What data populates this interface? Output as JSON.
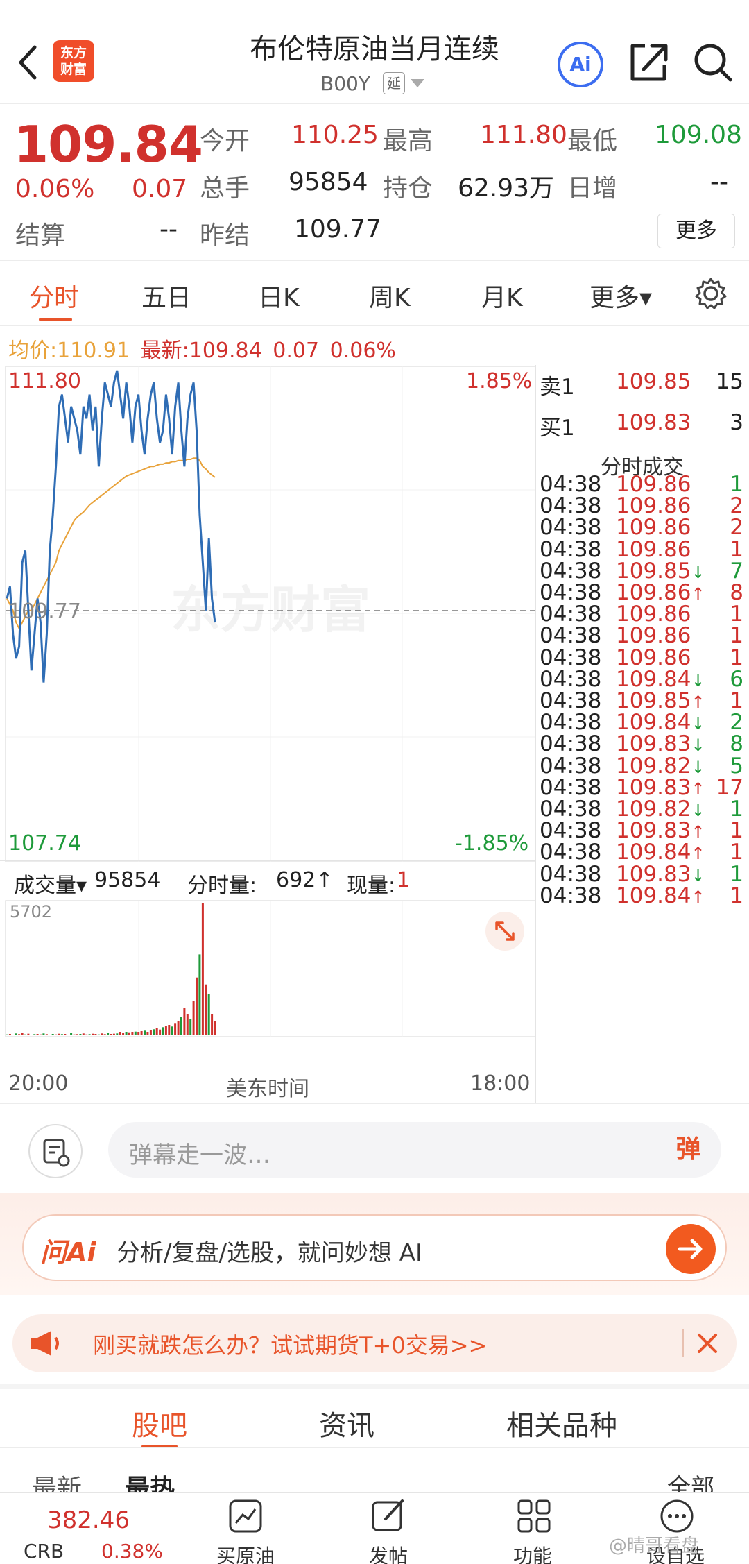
{
  "header": {
    "back_icon": "chevron-left-icon",
    "logo_text": "东方\n财富",
    "title": "布伦特原油当月连续",
    "code": "B00Y",
    "code_tag": "延",
    "ai_label": "Ai"
  },
  "quote": {
    "price": "109.84",
    "change_pct": "0.06%",
    "change": "0.07",
    "open_label": "今开",
    "open": "110.25",
    "high_label": "最高",
    "high": "111.80",
    "low_label": "最低",
    "low": "109.08",
    "volume_label": "总手",
    "volume": "95854",
    "oi_label": "持仓",
    "oi": "62.93万",
    "daily_inc_label": "日增",
    "daily_inc": "--",
    "settle_label": "结算",
    "settle": "--",
    "prev_settle_label": "昨结",
    "prev_settle": "109.77",
    "more_label": "更多"
  },
  "tabs": [
    "分时",
    "五日",
    "日K",
    "周K",
    "月K",
    "更多▾"
  ],
  "avg_line": {
    "avg_label": "均价:",
    "avg": "110.91",
    "latest_label": "最新:",
    "latest": "109.84",
    "chg": "0.07",
    "pct": "0.06%"
  },
  "chart_labels": {
    "top_price": "111.80",
    "top_pct": "1.85%",
    "mid_price": "109.77",
    "bottom_price": "107.74",
    "bottom_pct": "-1.85%",
    "watermark": "东方财富",
    "vol_max": "5702",
    "time_start": "20:00",
    "time_mid": "美东时间",
    "time_end": "18:00"
  },
  "chart_data": {
    "type": "line",
    "ylim": [
      107.74,
      111.8
    ],
    "series": [
      {
        "values": [
          109.9,
          110.0,
          109.6,
          109.4,
          109.5,
          110.2,
          110.3,
          109.8,
          109.3,
          109.6,
          109.9,
          109.7,
          109.2,
          109.6,
          110.3,
          110.6,
          111.0,
          111.5,
          111.6,
          111.4,
          111.2,
          111.5,
          111.4,
          111.3,
          111.1,
          111.5,
          111.4,
          111.6,
          111.3,
          111.5,
          111.0,
          111.4,
          111.7,
          111.6,
          111.5,
          111.7,
          111.8,
          111.6,
          111.4,
          111.7,
          111.5,
          111.2,
          111.5,
          111.6,
          111.3,
          111.1,
          111.4,
          111.6,
          111.7,
          111.4,
          111.2,
          111.3,
          111.6,
          111.4,
          111.1,
          111.5,
          111.7,
          111.3,
          111.0,
          111.4,
          111.6,
          111.7,
          111.3,
          110.6,
          110.2,
          109.8,
          110.4,
          109.9,
          109.7
        ]
      },
      {
        "values": [
          109.9,
          109.85,
          109.8,
          109.7,
          109.65,
          109.7,
          109.75,
          109.8,
          109.8,
          109.85,
          109.9,
          109.95,
          110.0,
          110.05,
          110.1,
          110.15,
          110.2,
          110.3,
          110.35,
          110.4,
          110.45,
          110.5,
          110.55,
          110.58,
          110.6,
          110.62,
          110.65,
          110.68,
          110.7,
          110.72,
          110.74,
          110.76,
          110.78,
          110.8,
          110.82,
          110.84,
          110.86,
          110.88,
          110.9,
          110.92,
          110.93,
          110.94,
          110.95,
          110.96,
          110.97,
          110.98,
          110.99,
          111.0,
          111.0,
          111.01,
          111.02,
          111.02,
          111.03,
          111.03,
          111.04,
          111.04,
          111.05,
          111.05,
          111.05,
          111.06,
          111.06,
          111.07,
          111.07,
          111.05,
          111.0,
          110.98,
          110.95,
          110.93,
          110.91
        ]
      }
    ],
    "volume": [
      40,
      60,
      30,
      80,
      50,
      90,
      40,
      70,
      30,
      50,
      60,
      40,
      80,
      50,
      30,
      60,
      40,
      70,
      50,
      60,
      30,
      90,
      40,
      50,
      60,
      80,
      40,
      50,
      70,
      60,
      40,
      80,
      50,
      90,
      60,
      70,
      80,
      120,
      90,
      150,
      100,
      130,
      160,
      140,
      180,
      200,
      150,
      220,
      260,
      300,
      250,
      350,
      400,
      450,
      380,
      500,
      600,
      800,
      1200,
      900,
      700,
      1500,
      2500,
      3500,
      5702,
      2200,
      1800,
      900,
      600
    ]
  },
  "book": {
    "sell1_label": "卖1",
    "sell1_price": "109.85",
    "sell1_vol": "15",
    "buy1_label": "买1",
    "buy1_price": "109.83",
    "buy1_vol": "3",
    "ticks_title": "分时成交",
    "ticks": [
      {
        "t": "04:38",
        "p": "109.86",
        "a": "",
        "v": "1",
        "c": "red",
        "vc": "green"
      },
      {
        "t": "04:38",
        "p": "109.86",
        "a": "",
        "v": "2",
        "c": "red",
        "vc": "red"
      },
      {
        "t": "04:38",
        "p": "109.86",
        "a": "",
        "v": "2",
        "c": "red",
        "vc": "red"
      },
      {
        "t": "04:38",
        "p": "109.86",
        "a": "",
        "v": "1",
        "c": "red",
        "vc": "red"
      },
      {
        "t": "04:38",
        "p": "109.85",
        "a": "↓",
        "v": "7",
        "c": "red",
        "vc": "green"
      },
      {
        "t": "04:38",
        "p": "109.86",
        "a": "↑",
        "v": "8",
        "c": "red",
        "vc": "red"
      },
      {
        "t": "04:38",
        "p": "109.86",
        "a": "",
        "v": "1",
        "c": "red",
        "vc": "red"
      },
      {
        "t": "04:38",
        "p": "109.86",
        "a": "",
        "v": "1",
        "c": "red",
        "vc": "red"
      },
      {
        "t": "04:38",
        "p": "109.86",
        "a": "",
        "v": "1",
        "c": "red",
        "vc": "red"
      },
      {
        "t": "04:38",
        "p": "109.84",
        "a": "↓",
        "v": "6",
        "c": "red",
        "vc": "green"
      },
      {
        "t": "04:38",
        "p": "109.85",
        "a": "↑",
        "v": "1",
        "c": "red",
        "vc": "red"
      },
      {
        "t": "04:38",
        "p": "109.84",
        "a": "↓",
        "v": "2",
        "c": "red",
        "vc": "green"
      },
      {
        "t": "04:38",
        "p": "109.83",
        "a": "↓",
        "v": "8",
        "c": "red",
        "vc": "green"
      },
      {
        "t": "04:38",
        "p": "109.82",
        "a": "↓",
        "v": "5",
        "c": "red",
        "vc": "green"
      },
      {
        "t": "04:38",
        "p": "109.83",
        "a": "↑",
        "v": "17",
        "c": "red",
        "vc": "red"
      },
      {
        "t": "04:38",
        "p": "109.82",
        "a": "↓",
        "v": "1",
        "c": "red",
        "vc": "green"
      },
      {
        "t": "04:38",
        "p": "109.83",
        "a": "↑",
        "v": "1",
        "c": "red",
        "vc": "red"
      },
      {
        "t": "04:38",
        "p": "109.84",
        "a": "↑",
        "v": "1",
        "c": "red",
        "vc": "red"
      },
      {
        "t": "04:38",
        "p": "109.83",
        "a": "↓",
        "v": "1",
        "c": "red",
        "vc": "green"
      },
      {
        "t": "04:38",
        "p": "109.84",
        "a": "↑",
        "v": "1",
        "c": "red",
        "vc": "red"
      }
    ]
  },
  "volume_bar": {
    "select_label": "成交量▾",
    "total": "95854",
    "minute_label": "分时量:",
    "minute": "692↑",
    "now_label": "现量:",
    "now": "1"
  },
  "danmu": {
    "placeholder": "弹幕走一波…",
    "send_label": "弹"
  },
  "askai": {
    "brand": "问Ai",
    "text": "分析/复盘/选股，就问妙想 AI"
  },
  "promo": {
    "text": "刚买就跌怎么办？试试期货T+0交易>>"
  },
  "subtabs": [
    "股吧",
    "资讯",
    "相关品种"
  ],
  "sort": {
    "latest": "最新",
    "hot": "最热",
    "all": "全部"
  },
  "bottom_nav": {
    "crb_value": "382.46",
    "crb_label": "CRB",
    "crb_pct": "0.38%",
    "buy": "买原油",
    "post": "发帖",
    "func": "功能",
    "fav": "设自选",
    "watermark": "@晴哥看盘"
  },
  "colors": {
    "accent": "#e8542a",
    "up": "#d0312d",
    "down": "#1e9a3a",
    "price_line": "#2f6db5",
    "avg_line": "#e8a23a"
  }
}
